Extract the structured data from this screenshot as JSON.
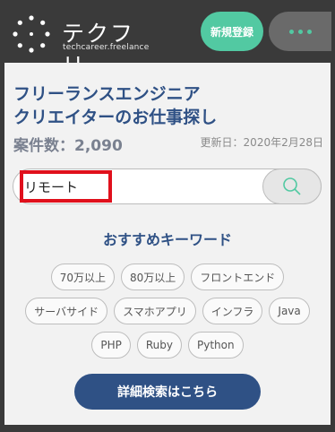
{
  "header": {
    "logo_text": "テクフリ",
    "logo_sub": "techcareer.freelance",
    "signup_label": "新規登録",
    "menu_icon": "dots-icon",
    "accent_color": "#52c9a2"
  },
  "hero": {
    "headline_line1": "フリーランスエンジニア",
    "headline_line2": "クリエイターのお仕事探し",
    "count_label": "案件数：2,090",
    "updated_label": "更新日：2020年2月28日"
  },
  "search": {
    "value": "リモート",
    "button_icon": "search-icon"
  },
  "keywords": {
    "title": "おすすめキーワード",
    "rows": [
      [
        "70万以上",
        "80万以上",
        "フロントエンド"
      ],
      [
        "サーバサイド",
        "スマホアプリ",
        "インフラ",
        "Java"
      ],
      [
        "PHP",
        "Ruby",
        "Python"
      ]
    ]
  },
  "detail_search_label": "詳細検索はこちら"
}
